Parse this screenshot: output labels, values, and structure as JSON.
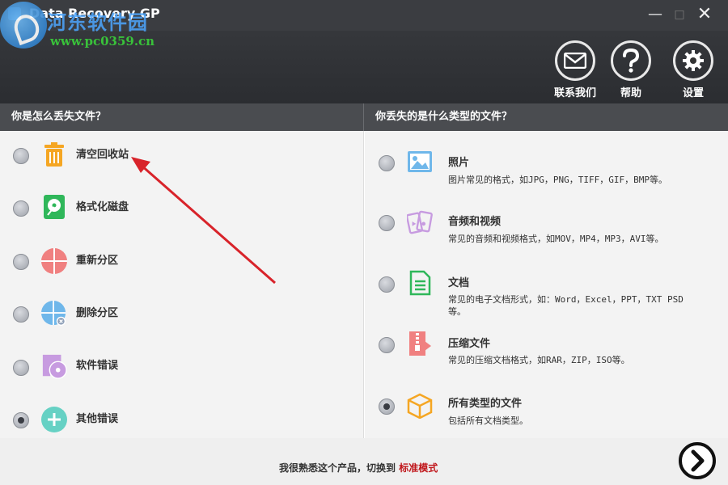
{
  "window": {
    "title": "Data Recovery GP",
    "controls": {
      "minimize": "—",
      "maximize": "□",
      "close": "✕"
    }
  },
  "watermark": {
    "name": "河东软件园",
    "url": "www.pc0359.cn"
  },
  "toolbar": {
    "contact_label": "联系我们",
    "help_label": "帮助",
    "settings_label": "设置"
  },
  "sections": {
    "left_title": "你是怎么丢失文件？",
    "right_title": "你丢失的是什么类型的文件？"
  },
  "loss_reasons": [
    {
      "label": "清空回收站",
      "icon": "trash-icon",
      "color": "#f5a623",
      "selected": false
    },
    {
      "label": "格式化磁盘",
      "icon": "disk-icon",
      "color": "#2fb75a",
      "selected": false
    },
    {
      "label": "重新分区",
      "icon": "partition-icon",
      "color": "#f08080",
      "selected": false
    },
    {
      "label": "删除分区",
      "icon": "delete-partition-icon",
      "color": "#6fb7ea",
      "selected": false
    },
    {
      "label": "软件错误",
      "icon": "disc-icon",
      "color": "#c79be0",
      "selected": false
    },
    {
      "label": "其他错误",
      "icon": "plus-icon",
      "color": "#66d1c4",
      "selected": true
    }
  ],
  "file_types": [
    {
      "title": "照片",
      "desc": "图片常见的格式，如JPG，PNG，TIFF，GIF，BMP等。",
      "icon": "image-icon",
      "color": "#6fb7ea",
      "selected": false
    },
    {
      "title": "音频和视频",
      "desc": "常见的音频和视频格式，如MOV，MP4，MP3，AVI等。",
      "icon": "media-icon",
      "color": "#c79be0",
      "selected": false
    },
    {
      "title": "文档",
      "desc": "常见的电子文档形式，如：Word，Excel，PPT，TXT PSD等。",
      "icon": "document-icon",
      "color": "#2fb75a",
      "selected": false
    },
    {
      "title": "压缩文件",
      "desc": "常见的压缩文档格式，如RAR，ZIP，ISO等。",
      "icon": "archive-icon",
      "color": "#f08080",
      "selected": false
    },
    {
      "title": "所有类型的文件",
      "desc": "包括所有文档类型。",
      "icon": "box-icon",
      "color": "#f5a623",
      "selected": true
    }
  ],
  "footer": {
    "text": "我很熟悉这个产品，切换到",
    "link": "标准模式"
  },
  "colors": {
    "header_bg": "#2b2d31",
    "accent_red": "#c0161b"
  }
}
